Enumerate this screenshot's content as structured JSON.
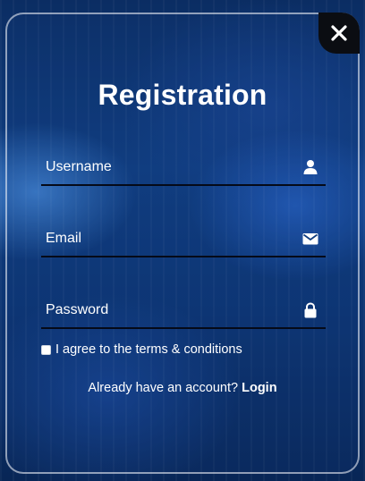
{
  "form": {
    "title": "Registration",
    "close_icon": "close-icon",
    "username": {
      "placeholder": "Username",
      "value": "",
      "icon": "user-icon"
    },
    "email": {
      "placeholder": "Email",
      "value": "",
      "icon": "envelope-icon"
    },
    "password": {
      "placeholder": "Password",
      "value": "",
      "icon": "lock-icon"
    },
    "terms": {
      "label": "I agree to the terms & conditions",
      "checked": false
    },
    "footer": {
      "prompt": "Already have an account?",
      "login_link": "Login"
    }
  },
  "colors": {
    "text": "#ffffff",
    "field_underline": "#050a18",
    "close_button_bg": "#0b0d12",
    "background": "#0f3d80"
  }
}
